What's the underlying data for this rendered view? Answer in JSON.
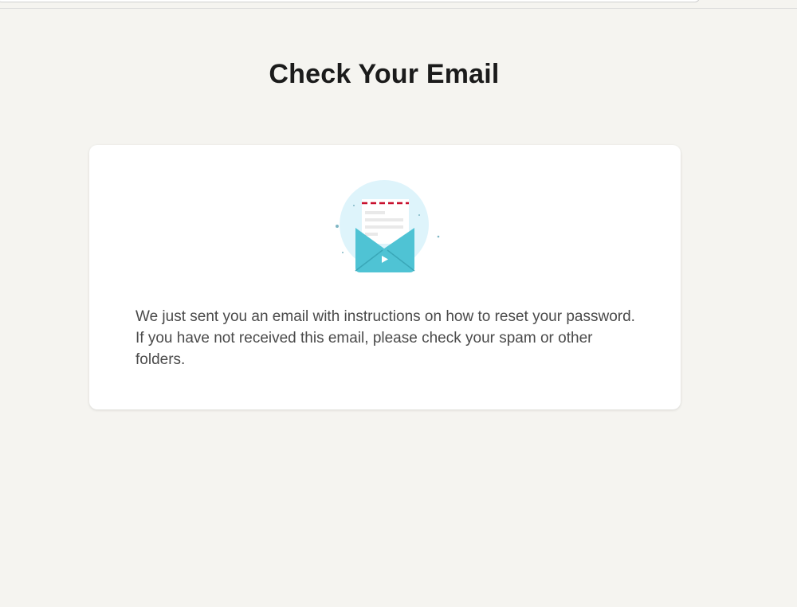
{
  "page": {
    "title": "Check Your Email"
  },
  "card": {
    "illustration_icon": "open-envelope-with-letter-icon",
    "message": "We just sent you an email with instructions on how to reset your password. If you have not received this email, please check your spam or other folders."
  },
  "colors": {
    "background": "#f5f4f0",
    "card": "#ffffff",
    "envelope": "#4fc3d4",
    "envelope_circle": "#def4fb",
    "letter_dash": "#c8102e",
    "heading_text": "#1b1b1b",
    "body_text": "#4a4a4a"
  }
}
